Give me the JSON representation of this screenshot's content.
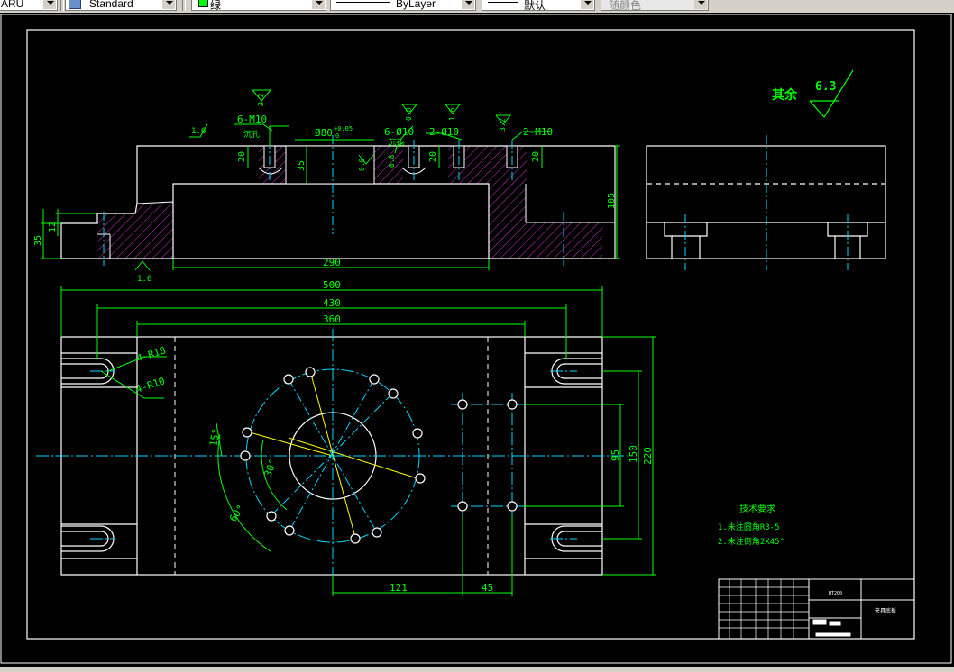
{
  "toolbar": {
    "text_style_fragment": "ARU",
    "dim_style": "Standard",
    "layer_name": "绿",
    "layer_color": "#00ff00",
    "linetype": "ByLayer",
    "lineweight": "默认",
    "plot_style": "随颜色"
  },
  "drawing": {
    "roughness_rest_label": "其余",
    "roughness_rest_value": "6.3",
    "front_view": {
      "roughness_left_top": "1.6",
      "roughness_left_bottom": "1.6",
      "callouts": [
        "6-M10",
        "沉孔",
        "Ø80",
        "+0.05",
        "0",
        "6-Ø10",
        "沉孔",
        "2-Ø10",
        "2-M10"
      ],
      "roughness_marks": [
        "3.2",
        "0.8",
        "0.8",
        "1.6",
        "0.8",
        "3.2"
      ],
      "dims": {
        "d20a": "20",
        "d35": "35",
        "d20b": "20",
        "d20c": "20",
        "d105": "105",
        "d35l": "35",
        "d12": "12",
        "d290": "290"
      }
    },
    "plan_view": {
      "dims": {
        "d500": "500",
        "d430": "430",
        "d360": "360",
        "d220": "220",
        "d150": "150",
        "d95": "95",
        "d121": "121",
        "d45": "45"
      },
      "angles": {
        "a15": "15°",
        "a30": "30°",
        "a60": "60°"
      },
      "leaders": [
        "4-R18",
        "4-R10"
      ]
    },
    "tech_req": {
      "title": "技术要求",
      "items": [
        "1.未注圆角R3-5",
        "2.未注倒角2X45°"
      ]
    },
    "title_block": {
      "material": "HT200",
      "drawing_name": "夹具底板"
    },
    "colors": {
      "outline": "#ffffff",
      "dim": "#00ff00",
      "center": "#00d7ff",
      "hatch": "#cc33cc",
      "yellow": "#ffff00",
      "text": "#00ff00"
    }
  }
}
